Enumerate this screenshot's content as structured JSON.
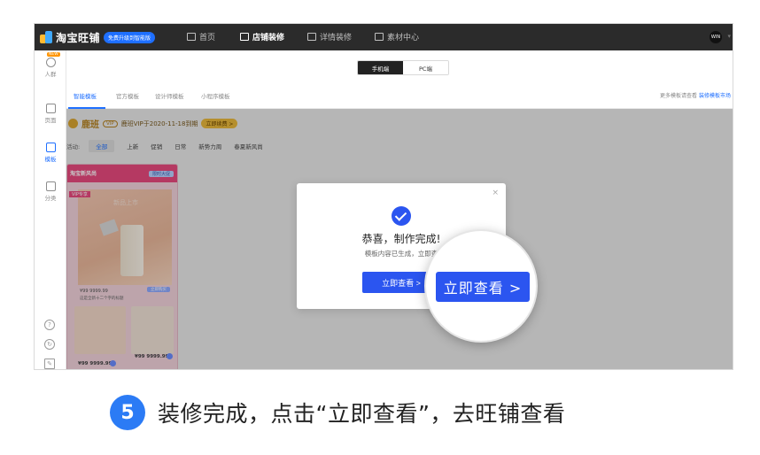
{
  "topbar": {
    "brand": "淘宝旺铺",
    "upgrade_badge": "免费升级到智能版",
    "nav": [
      {
        "label": "首页",
        "active": false
      },
      {
        "label": "店铺装修",
        "active": true
      },
      {
        "label": "详情装修",
        "active": false
      },
      {
        "label": "素材中心",
        "active": false
      }
    ],
    "user_initials": "WIN"
  },
  "sidebar": {
    "items": [
      {
        "label": "人群",
        "badge": "NEW"
      },
      {
        "label": "页面"
      },
      {
        "label": "模板"
      },
      {
        "label": "分类"
      }
    ]
  },
  "device_toggle": {
    "mobile": "手机端",
    "pc": "PC端"
  },
  "tabs": [
    "智能模板",
    "官方模板",
    "设计师模板",
    "小程序模板"
  ],
  "more_link": {
    "prefix": "更多模板请查看",
    "link": "装修模板市场"
  },
  "vip": {
    "brand": "鹿班",
    "tag": "VIP",
    "expiry": "鹿班VIP于2020-11-18到期",
    "renew": "立即续费 >"
  },
  "filters": {
    "label": "活动:",
    "options": [
      "全部",
      "上新",
      "促销",
      "日常",
      "新势力周",
      "春夏新风尚"
    ],
    "selected": "全部"
  },
  "card": {
    "logo": "淘宝新风尚",
    "limited": "限时大促",
    "vip": "VIP专享",
    "hero_title": "新品上市",
    "price": "¥99 9999.99",
    "buy": "立即购买",
    "desc": "这是全新十二个字的标题",
    "mini_price": "¥99 9999.99",
    "mini_price2": "¥99 9999.99"
  },
  "modal": {
    "close": "×",
    "title": "恭喜，制作完成!",
    "subtitle": "模板内容已生成，立即查",
    "button": "立即查看 >"
  },
  "magnifier": {
    "button": "立即查看 >"
  },
  "caption": {
    "step": "5",
    "text": "装修完成，点击“立即查看”，去旺铺查看"
  },
  "colors": {
    "accent": "#2b55f0",
    "topbar": "#2b2b2b",
    "step_badge": "#2b7bf5",
    "vip_gold": "#b58220"
  }
}
